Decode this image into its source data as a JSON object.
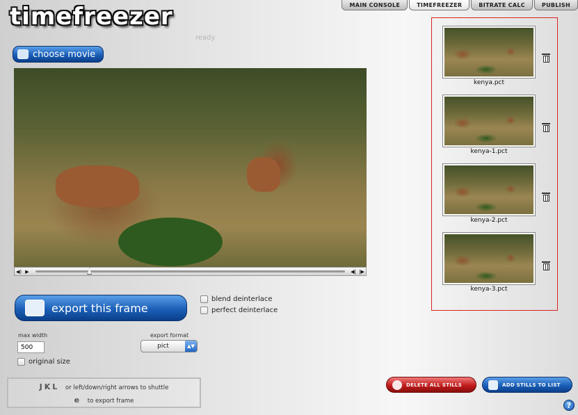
{
  "app": {
    "logo": "timefreezer",
    "status": "ready"
  },
  "tabs": [
    {
      "label": "MAIN CONSOLE",
      "active": false
    },
    {
      "label": "TIMEFREEZER",
      "active": true
    },
    {
      "label": "BITRATE CALC",
      "active": false
    },
    {
      "label": "PUBLISH",
      "active": false
    }
  ],
  "buttons": {
    "choose_movie": "choose movie",
    "export_frame": "export this frame",
    "delete_all": "DELETE ALL STILLS",
    "add_stills": "ADD STILLS TO LIST",
    "help": "?"
  },
  "player": {
    "volume_icon": "speaker-icon",
    "play_icon": "play-icon",
    "step_back_icon": "step-back-icon",
    "step_forward_icon": "step-forward-icon"
  },
  "options": {
    "blend_deinterlace": "blend deinterlace",
    "perfect_deinterlace": "perfect deinterlace",
    "max_width_label": "max width",
    "max_width_value": "500",
    "original_size": "original size",
    "export_format_label": "export format",
    "export_format_value": "pict"
  },
  "help": {
    "line1_keys": "JKL",
    "line1_text": "or left/down/right arrows to shuttle",
    "line2_key": "e",
    "line2_text": "to export frame"
  },
  "stills": [
    {
      "name": "kenya.pct"
    },
    {
      "name": "kenya-1.pct"
    },
    {
      "name": "kenya-2.pct"
    },
    {
      "name": "kenya-3.pct"
    }
  ],
  "colors": {
    "accent_blue": "#1b5fb8",
    "danger_red": "#c21c1c",
    "stills_border": "#d92222"
  }
}
